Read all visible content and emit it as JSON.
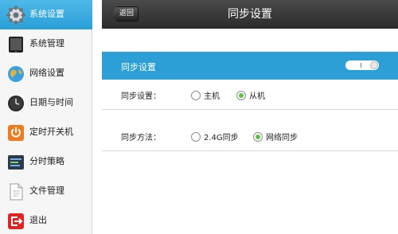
{
  "sidebar": {
    "items": [
      {
        "label": "系统设置",
        "icon": "gear-icon"
      },
      {
        "label": "系统管理",
        "icon": "tablet-icon"
      },
      {
        "label": "网络设置",
        "icon": "globe-icon"
      },
      {
        "label": "日期与时间",
        "icon": "clock-icon"
      },
      {
        "label": "定时开关机",
        "icon": "power-icon"
      },
      {
        "label": "分时策略",
        "icon": "schedule-icon"
      },
      {
        "label": "文件管理",
        "icon": "document-icon"
      },
      {
        "label": "退出",
        "icon": "exit-icon"
      }
    ],
    "active_index": 0
  },
  "header": {
    "back_label": "返回",
    "title": "同步设置"
  },
  "settings": {
    "sync_toggle_label": "同步设置",
    "sync_toggle_on": true,
    "sync_role": {
      "label": "同步设置：",
      "options": [
        "主机",
        "从机"
      ],
      "selected": "从机"
    },
    "sync_method": {
      "label": "同步方法：",
      "options": [
        "2.4G同步",
        "网络同步"
      ],
      "selected": "网络同步"
    }
  },
  "colors": {
    "accent": "#2b9fd6",
    "header_bg": "#333333",
    "radio_on": "#5fc34a"
  }
}
